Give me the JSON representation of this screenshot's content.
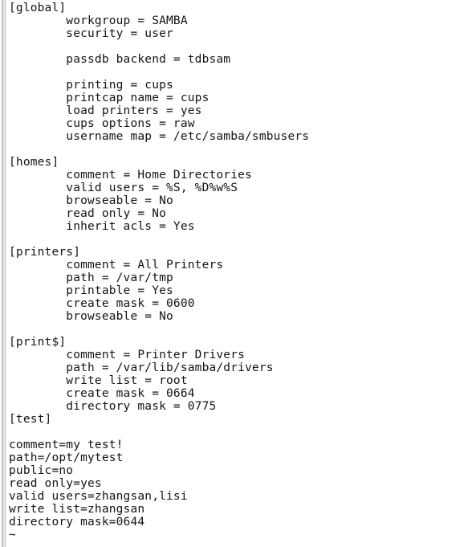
{
  "app": {
    "kind": "terminal-text-editor",
    "document_name": "smb.conf",
    "text_color": "#141414",
    "background_color": "#ffffff",
    "scrollbar_color": "#adadad"
  },
  "scrollbar": {
    "label": "vertical-scrollbar",
    "position": "left"
  },
  "document": {
    "lines": [
      "[global]",
      "        workgroup = SAMBA",
      "        security = user",
      "",
      "        passdb backend = tdbsam",
      "",
      "        printing = cups",
      "        printcap name = cups",
      "        load printers = yes",
      "        cups options = raw",
      "        username map = /etc/samba/smbusers",
      "",
      "[homes]",
      "        comment = Home Directories",
      "        valid users = %S, %D%w%S",
      "        browseable = No",
      "        read only = No",
      "        inherit acls = Yes",
      "",
      "[printers]",
      "        comment = All Printers",
      "        path = /var/tmp",
      "        printable = Yes",
      "        create mask = 0600",
      "        browseable = No",
      "",
      "[print$]",
      "        comment = Printer Drivers",
      "        path = /var/lib/samba/drivers",
      "        write list = root",
      "        create mask = 0664",
      "        directory mask = 0775",
      "[test]",
      "",
      "comment=my test!",
      "path=/opt/mytest",
      "public=no",
      "read only=yes",
      "valid users=zhangsan,lisi",
      "write list=zhangsan",
      "directory mask=0644",
      "~"
    ],
    "sections": [
      {
        "name": "[global]",
        "settings": [
          {
            "key": "workgroup",
            "value": "SAMBA"
          },
          {
            "key": "security",
            "value": "user"
          },
          {
            "key": "passdb backend",
            "value": "tdbsam"
          },
          {
            "key": "printing",
            "value": "cups"
          },
          {
            "key": "printcap name",
            "value": "cups"
          },
          {
            "key": "load printers",
            "value": "yes"
          },
          {
            "key": "cups options",
            "value": "raw"
          },
          {
            "key": "username map",
            "value": "/etc/samba/smbusers"
          }
        ]
      },
      {
        "name": "[homes]",
        "settings": [
          {
            "key": "comment",
            "value": "Home Directories"
          },
          {
            "key": "valid users",
            "value": "%S, %D%w%S"
          },
          {
            "key": "browseable",
            "value": "No"
          },
          {
            "key": "read only",
            "value": "No"
          },
          {
            "key": "inherit acls",
            "value": "Yes"
          }
        ]
      },
      {
        "name": "[printers]",
        "settings": [
          {
            "key": "comment",
            "value": "All Printers"
          },
          {
            "key": "path",
            "value": "/var/tmp"
          },
          {
            "key": "printable",
            "value": "Yes"
          },
          {
            "key": "create mask",
            "value": "0600"
          },
          {
            "key": "browseable",
            "value": "No"
          }
        ]
      },
      {
        "name": "[print$]",
        "settings": [
          {
            "key": "comment",
            "value": "Printer Drivers"
          },
          {
            "key": "path",
            "value": "/var/lib/samba/drivers"
          },
          {
            "key": "write list",
            "value": "root"
          },
          {
            "key": "create mask",
            "value": "0664"
          },
          {
            "key": "directory mask",
            "value": "0775"
          }
        ]
      },
      {
        "name": "[test]",
        "settings": [
          {
            "key": "comment",
            "value": "my test!"
          },
          {
            "key": "path",
            "value": "/opt/mytest"
          },
          {
            "key": "public",
            "value": "no"
          },
          {
            "key": "read only",
            "value": "yes"
          },
          {
            "key": "valid users",
            "value": "zhangsan,lisi"
          },
          {
            "key": "write list",
            "value": "zhangsan"
          },
          {
            "key": "directory mask",
            "value": "0644"
          }
        ]
      }
    ],
    "end_of_buffer_marker": "~"
  }
}
